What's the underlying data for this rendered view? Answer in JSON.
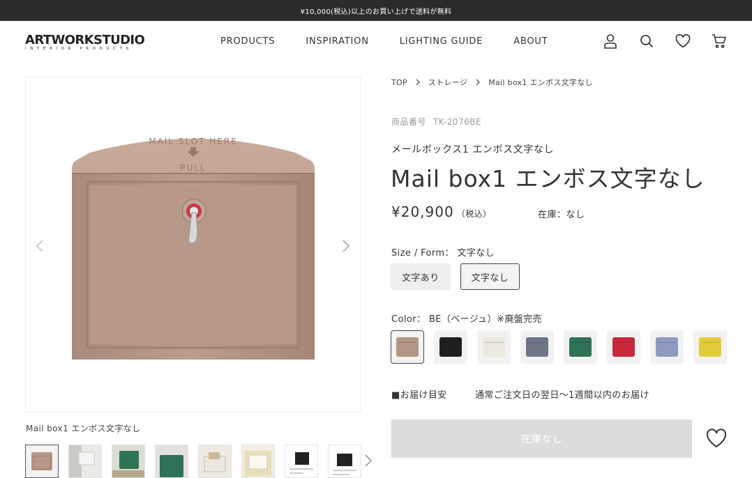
{
  "announcement": "¥10,000(税込)以上のお買い上げで送料が無料",
  "header": {
    "logo_main": "ARTWORKSTUDIO",
    "logo_sub": "INTERIOR PRODUCTS",
    "nav": [
      "PRODUCTS",
      "INSPIRATION",
      "LIGHTING GUIDE",
      "ABOUT"
    ],
    "icons": [
      "account-icon",
      "search-icon",
      "heart-icon",
      "cart-icon"
    ]
  },
  "breadcrumb": [
    "TOP",
    "ストレージ",
    "Mail box1 エンボス文字なし"
  ],
  "product": {
    "sku_label": "商品番号",
    "sku": "TK-2076BE",
    "subtitle": "メールボックス1 エンボス文字なし",
    "title": "Mail box1 エンボス文字なし",
    "price": "¥20,900",
    "tax_note": "（税込）",
    "stock": "在庫：なし"
  },
  "image": {
    "caption": "Mail box1 エンボス文字なし",
    "embossed_text_1": "MAIL SLOT HERE",
    "embossed_text_2": "PULL",
    "thumbnail_count": 8
  },
  "size_option": {
    "label": "Size / Form：",
    "selected": "文字なし",
    "choices": [
      "文字あり",
      "文字なし"
    ]
  },
  "color_option": {
    "label": "Color：",
    "selected": "BE（ベージュ）※廃盤完売",
    "swatches": [
      "#b49686",
      "#1f1f1f",
      "#ebe8e0",
      "#6e7587",
      "#2f7356",
      "#c8283a",
      "#8f9ac0",
      "#e3cc3a"
    ]
  },
  "delivery": {
    "label": "■お届け目安",
    "value": "通常ご注文日の翌日〜1週間以内のお届け"
  },
  "cart_button": "在庫なし"
}
